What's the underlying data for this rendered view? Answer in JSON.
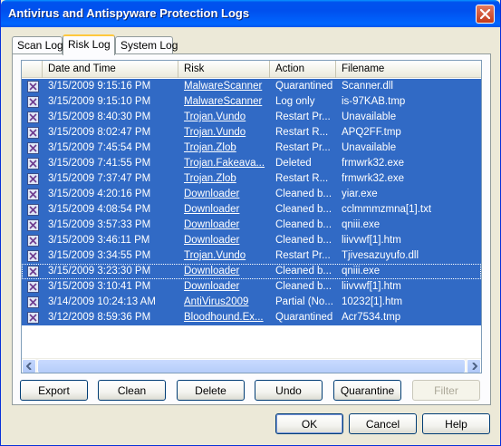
{
  "window": {
    "title": "Antivirus and Antispyware Protection Logs",
    "close_icon": "close-icon"
  },
  "tabs": [
    {
      "label": "Scan Log",
      "active": false
    },
    {
      "label": "Risk Log",
      "active": true
    },
    {
      "label": "System Log",
      "active": false
    }
  ],
  "list": {
    "columns": [
      "",
      "Date and Time",
      "Risk",
      "Action",
      "Filename"
    ],
    "row_icon": "risk-entry-icon",
    "rows": [
      {
        "date": "3/15/2009 9:15:16 PM",
        "risk": "MalwareScanner",
        "action": "Quarantined",
        "filename": "Scanner.dll"
      },
      {
        "date": "3/15/2009 9:15:10 PM",
        "risk": "MalwareScanner",
        "action": "Log only",
        "filename": "is-97KAB.tmp"
      },
      {
        "date": "3/15/2009 8:40:30 PM",
        "risk": "Trojan.Vundo",
        "action": "Restart Pr...",
        "filename": "Unavailable"
      },
      {
        "date": "3/15/2009 8:02:47 PM",
        "risk": "Trojan.Vundo",
        "action": "Restart R...",
        "filename": "APQ2FF.tmp"
      },
      {
        "date": "3/15/2009 7:45:54 PM",
        "risk": "Trojan.Zlob",
        "action": "Restart Pr...",
        "filename": "Unavailable"
      },
      {
        "date": "3/15/2009 7:41:55 PM",
        "risk": "Trojan.Fakeava...",
        "action": "Deleted",
        "filename": "frmwrk32.exe"
      },
      {
        "date": "3/15/2009 7:37:47 PM",
        "risk": "Trojan.Zlob",
        "action": "Restart R...",
        "filename": "frmwrk32.exe"
      },
      {
        "date": "3/15/2009 4:20:16 PM",
        "risk": "Downloader",
        "action": "Cleaned b...",
        "filename": "yiar.exe"
      },
      {
        "date": "3/15/2009 4:08:54 PM",
        "risk": "Downloader",
        "action": "Cleaned b...",
        "filename": "cclmmmzmna[1].txt"
      },
      {
        "date": "3/15/2009 3:57:33 PM",
        "risk": "Downloader",
        "action": "Cleaned b...",
        "filename": "qniii.exe"
      },
      {
        "date": "3/15/2009 3:46:11 PM",
        "risk": "Downloader",
        "action": "Cleaned b...",
        "filename": "liivvwf[1].htm"
      },
      {
        "date": "3/15/2009 3:34:55 PM",
        "risk": "Trojan.Vundo",
        "action": "Restart Pr...",
        "filename": "Tjivesazuyufo.dll"
      },
      {
        "date": "3/15/2009 3:23:30 PM",
        "risk": "Downloader",
        "action": "Cleaned b...",
        "filename": "qniii.exe"
      },
      {
        "date": "3/15/2009 3:10:41 PM",
        "risk": "Downloader",
        "action": "Cleaned b...",
        "filename": "liivvwf[1].htm"
      },
      {
        "date": "3/14/2009 10:24:13 AM",
        "risk": "AntiVirus2009",
        "action": "Partial (No...",
        "filename": "10232[1].htm"
      },
      {
        "date": "3/12/2009 8:59:36 PM",
        "risk": "Bloodhound.Ex...",
        "action": "Quarantined",
        "filename": "Acr7534.tmp"
      }
    ]
  },
  "scrollbar": {
    "left_icon": "scroll-left-icon",
    "right_icon": "scroll-right-icon"
  },
  "actions": {
    "export": "Export",
    "clean": "Clean",
    "delete": "Delete",
    "undo": "Undo",
    "quarantine": "Quarantine",
    "filter": "Filter"
  },
  "dialog": {
    "ok": "OK",
    "cancel": "Cancel",
    "help": "Help"
  },
  "colors": {
    "titlebar": "#0054e3",
    "selection": "#316ac5",
    "face": "#ece9d8"
  }
}
